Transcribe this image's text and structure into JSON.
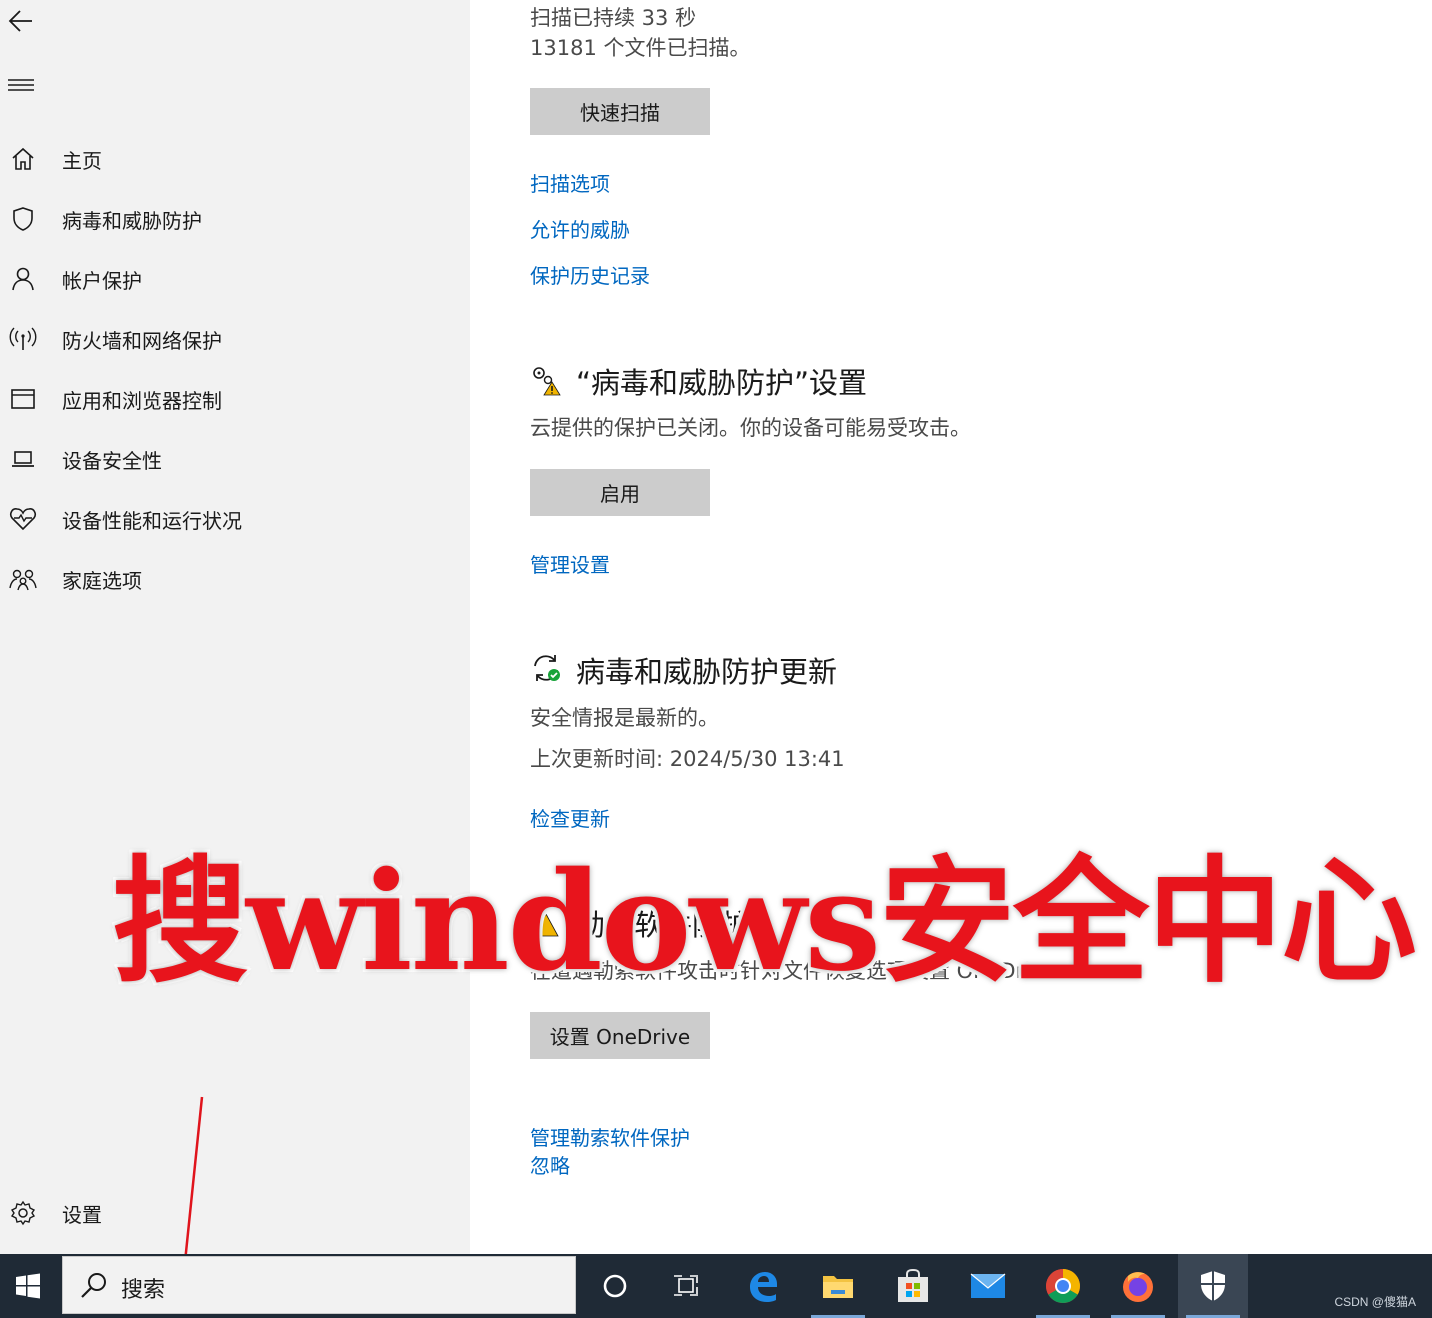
{
  "sidebar": {
    "items": [
      {
        "label": "主页",
        "icon": "home-icon"
      },
      {
        "label": "病毒和威胁防护",
        "icon": "shield-icon"
      },
      {
        "label": "帐户保护",
        "icon": "person-icon"
      },
      {
        "label": "防火墙和网络保护",
        "icon": "wifi-icon"
      },
      {
        "label": "应用和浏览器控制",
        "icon": "app-window-icon"
      },
      {
        "label": "设备安全性",
        "icon": "laptop-icon"
      },
      {
        "label": "设备性能和运行状况",
        "icon": "heart-pulse-icon"
      },
      {
        "label": "家庭选项",
        "icon": "family-icon"
      }
    ],
    "settings_label": "设置"
  },
  "scan": {
    "duration_text": "扫描已持续 33 秒",
    "files_text": "13181 个文件已扫描。",
    "quick_scan_button": "快速扫描",
    "links": [
      "扫描选项",
      "允许的威胁",
      "保护历史记录"
    ]
  },
  "settings_section": {
    "title": "“病毒和威胁防护”设置",
    "description": "云提供的保护已关闭。你的设备可能易受攻击。",
    "enable_button": "启用",
    "manage_link": "管理设置"
  },
  "updates_section": {
    "title": "病毒和威胁防护更新",
    "status": "安全情报是最新的。",
    "last_update": "上次更新时间: 2024/5/30 13:41",
    "check_link": "检查更新"
  },
  "ransomware_section": {
    "title_partial": "勒索软件防护",
    "description": "在遭遇勒索软件攻击时针对文件恢复选项设置 OneDrive。",
    "setup_button": "设置 OneDrive",
    "manage_link": "管理勒索软件保护",
    "dismiss_link": "忽略"
  },
  "overlay": {
    "text": "搜windows安全中心",
    "color": "#e8141c"
  },
  "taskbar": {
    "search_text": "搜索",
    "icons": [
      "cortana-icon",
      "task-view-icon",
      "edge-icon",
      "file-explorer-icon",
      "store-icon",
      "mail-icon",
      "chrome-icon",
      "firefox-icon",
      "windows-security-icon"
    ],
    "watermark": "CSDN @傻猫A"
  },
  "colors": {
    "link": "#0067c0",
    "sidebar_bg": "#f2f2f2",
    "button_bg": "#cccccc",
    "taskbar_bg": "#1f2a36"
  }
}
